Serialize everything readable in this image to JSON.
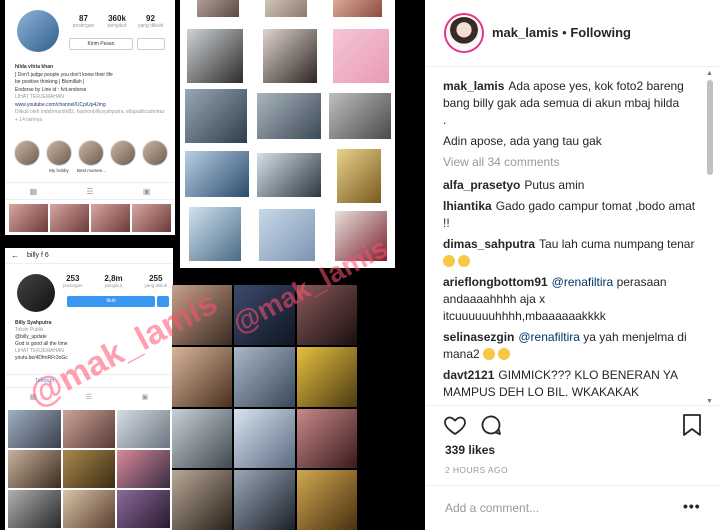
{
  "post": {
    "username": "mak_lamis",
    "separator": "•",
    "follow_label": "Following",
    "caption_user": "mak_lamis",
    "caption_line1": "Ada apose yes, kok foto2 bareng bang billy gak ada semua di akun mbaj hilda",
    "caption_line2": ".",
    "caption_line3": "Adin apose, ada yang tau gak",
    "view_all": "View all 34 comments",
    "likes": "339 likes",
    "time": "2 HOURS AGO",
    "add_comment_placeholder": "Add a comment...",
    "more_label": "•••"
  },
  "comments": [
    {
      "user": "alfa_prasetyo",
      "text": "Putus amin"
    },
    {
      "user": "lhiantika",
      "text": "Gado gado campur tomat ,bodo amat !!"
    },
    {
      "user": "dimas_sahputra",
      "text": "Tau lah cuma numpang tenar"
    },
    {
      "user": "arieflongbottom91",
      "mention": "@renafiltira",
      "text": "perasaan andaaaahhhh aja x itcuuuuuuhhhh,mbaaaaaakkkk"
    },
    {
      "user": "selinasezgin",
      "mention": "@renafiltira",
      "text": "ya yah menjelma di mana2"
    },
    {
      "user": "davt2121",
      "text": "GIMMICK??? KLO BENERAN YA MAMPUS DEH LO BIL. WKAKAKAK"
    }
  ],
  "icons": {
    "like": "heart-icon",
    "comment": "comment-icon",
    "save": "bookmark-icon"
  },
  "colors": {
    "accent": "#3897f0",
    "avatar_ring": "#e8318a",
    "watermark": "#ff506e",
    "mention": "#003569"
  },
  "profile_a": {
    "posts": "87",
    "posts_label": "postingan",
    "followers": "360k",
    "followers_label": "pengikut",
    "following": "92",
    "following_label": "yang diikuti",
    "button": "Kirim Pesan",
    "name": "hilda vitria khan",
    "bio1": "[ Don't judge people you don't know their life",
    "bio2": "be positive thinking | Bismillah |",
    "bio3": "Endorse by Line id : fvit.endorse",
    "translate": "LIHAT TERJEMAHAN",
    "link": "www.youtube.com/channel/UCpiUp4Jmg",
    "followed_by": "Diikuti oleh indahmardin82, fashionbillysyahputra, ellapublicadmiraz + 14 lainnya",
    "highlights": [
      "",
      "My hobby",
      "Best momen...",
      "",
      ""
    ]
  },
  "profile_c": {
    "handle": "billy f 6",
    "posts": "253",
    "posts_label": "postingan",
    "followers": "2,8m",
    "followers_label": "pengikut",
    "following": "255",
    "following_label": "yang diikuti",
    "button": "Ikuti",
    "name": "Billy Syahputra",
    "category": "Tokoh Publik",
    "handle2": "@billy_update",
    "bio": "God is good all the time",
    "translate": "LIHAT TERJEMAHAN",
    "link": "youtu.be/4DfmRFr3oGc",
    "phone": "Telepon"
  },
  "watermark": "@mak_lamis"
}
